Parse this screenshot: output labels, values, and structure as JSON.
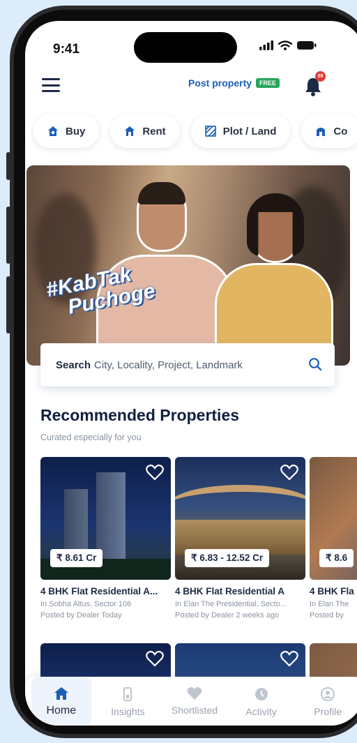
{
  "status": {
    "time": "9:41"
  },
  "header": {
    "post_label": "Post property",
    "free_badge": "FREE",
    "bell_count": "99"
  },
  "chips": [
    {
      "label": "Buy",
      "icon": "house-search-icon"
    },
    {
      "label": "Rent",
      "icon": "house-key-icon"
    },
    {
      "label": "Plot / Land",
      "icon": "plot-icon"
    },
    {
      "label": "Co",
      "icon": "commercial-icon"
    }
  ],
  "banner": {
    "hashtag_line1": "#KabTak",
    "hashtag_line2": "Puchoge"
  },
  "search": {
    "bold": "Search",
    "placeholder": "City, Locality, Project, Landmark"
  },
  "section": {
    "title": "Recommended Properties",
    "subtitle": "Curated especially for you"
  },
  "cards": [
    {
      "price": "₹ 8.61 Cr",
      "title": "4 BHK Flat Residential A...",
      "location": "In Sobha Altus, Sector 106",
      "posted": "Posted by Dealer Today"
    },
    {
      "price": "₹ 6.83  - 12.52 Cr",
      "title": "4 BHK Flat Residential A",
      "location": "In Elan The Presidential, Secto...",
      "posted": "Posted by Dealer 2 weeks ago"
    },
    {
      "price": "₹ 8.6",
      "title": "4 BHK Fla",
      "location": "In Elan The",
      "posted": "Posted by"
    }
  ],
  "tabs": [
    {
      "label": "Home",
      "icon": "home-icon"
    },
    {
      "label": "Insights",
      "icon": "insights-icon"
    },
    {
      "label": "Shortlisted",
      "icon": "heart-icon"
    },
    {
      "label": "Activity",
      "icon": "activity-icon"
    },
    {
      "label": "Profile",
      "icon": "profile-icon"
    }
  ],
  "colors": {
    "brand_blue": "#1b5fb8",
    "free_green": "#26a65b",
    "badge_red": "#e53935",
    "navy_text": "#102040"
  }
}
